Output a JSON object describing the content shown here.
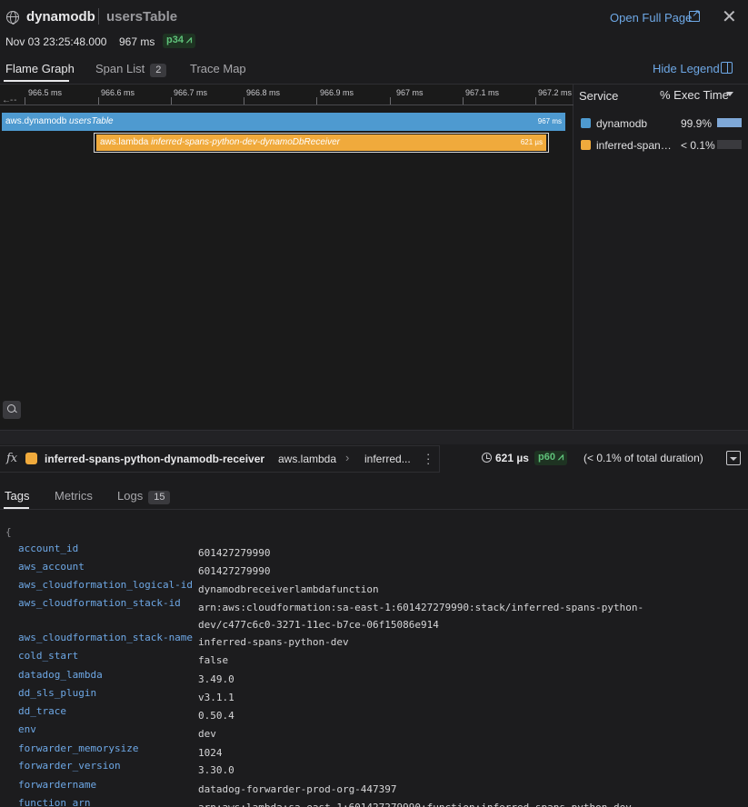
{
  "header": {
    "service": "dynamodb",
    "resource": "usersTable",
    "open_full_page": "Open Full Page",
    "timestamp": "Nov 03 23:25:48.000",
    "duration": "967 ms",
    "percentile": "p34"
  },
  "tabs": [
    {
      "label": "Flame Graph"
    },
    {
      "label": "Span List",
      "count": "2"
    },
    {
      "label": "Trace Map"
    }
  ],
  "hide_legend": "Hide Legend",
  "flame": {
    "ticks": [
      "966.5 ms",
      "966.6 ms",
      "966.7 ms",
      "966.8 ms",
      "966.9 ms",
      "967 ms",
      "967.1 ms",
      "967.2 ms"
    ],
    "spans": [
      {
        "service": "aws.dynamodb",
        "resource": "usersTable",
        "duration": "967 ms",
        "color": "#4e9ad0"
      },
      {
        "service": "aws.lambda",
        "resource": "inferred-spans-python-dev-dynamoDbReceiver",
        "duration": "621 µs",
        "color": "#f0aa3c"
      }
    ]
  },
  "legend": {
    "col_service": "Service",
    "col_exec": "% Exec Time",
    "rows": [
      {
        "name": "dynamodb",
        "pct": "99.9%",
        "color": "#4e9ad0",
        "fill": 0.999
      },
      {
        "name": "inferred-spans-python-dynamodb-receiver",
        "pct": "< 0.1%",
        "color": "#f0aa3c",
        "fill": 0.001
      }
    ]
  },
  "span": {
    "fx": "fx",
    "name": "inferred-spans-python-dynamodb-receiver",
    "service": "aws.lambda",
    "resource": "inferred...",
    "duration": "621 µs",
    "percentile": "p60",
    "pct_total": "(< 0.1% of total duration)"
  },
  "bottom_tabs": [
    {
      "label": "Tags"
    },
    {
      "label": "Metrics"
    },
    {
      "label": "Logs",
      "count": "15"
    }
  ],
  "tags": {
    "open_brace": "{",
    "rows": [
      {
        "key": "account_id",
        "value": "601427279990"
      },
      {
        "key": "aws_account",
        "value": "601427279990"
      },
      {
        "key": "aws_cloudformation_logical-id",
        "value": "dynamodbreceiverlambdafunction"
      },
      {
        "key": "aws_cloudformation_stack-id",
        "value": "arn:aws:cloudformation:sa-east-1:601427279990:stack/inferred-spans-python-",
        "value2": "dev/c477c6c0-3271-11ec-b7ce-06f15086e914"
      },
      {
        "key": "aws_cloudformation_stack-name",
        "value": "inferred-spans-python-dev"
      },
      {
        "key": "cold_start",
        "value": "false"
      },
      {
        "key": "datadog_lambda",
        "value": "3.49.0"
      },
      {
        "key": "dd_sls_plugin",
        "value": "v3.1.1"
      },
      {
        "key": "dd_trace",
        "value": "0.50.4"
      },
      {
        "key": "env",
        "value": "dev"
      },
      {
        "key": "forwarder_memorysize",
        "value": "1024"
      },
      {
        "key": "forwarder_version",
        "value": "3.30.0"
      },
      {
        "key": "forwardername",
        "value": "datadog-forwarder-prod-org-447397"
      },
      {
        "key": "function_arn",
        "value": "arn:aws:lambda:sa-east-1:601427279990:function:inferred-spans-python-dev-"
      }
    ]
  }
}
